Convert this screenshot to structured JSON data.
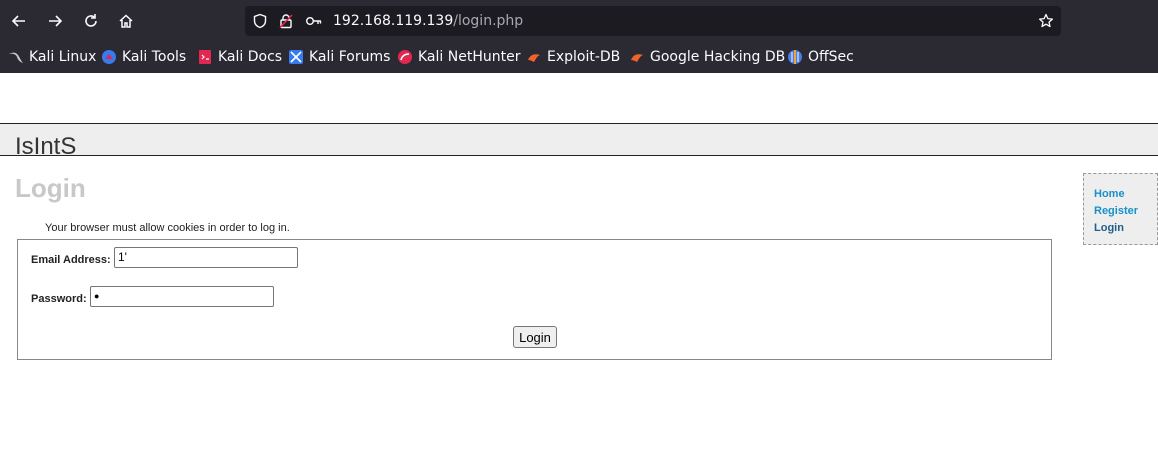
{
  "browser": {
    "url_host": "192.168.119.139",
    "url_path": "/login.php",
    "bookmarks": [
      {
        "label": "Kali Linux",
        "icon": "kali-dragon-icon"
      },
      {
        "label": "Kali Tools",
        "icon": "kali-tools-icon"
      },
      {
        "label": "Kali Docs",
        "icon": "kali-docs-icon"
      },
      {
        "label": "Kali Forums",
        "icon": "kali-forums-icon"
      },
      {
        "label": "Kali NetHunter",
        "icon": "kali-nethunter-icon"
      },
      {
        "label": "Exploit-DB",
        "icon": "exploit-db-icon"
      },
      {
        "label": "Google Hacking DB",
        "icon": "ghdb-icon"
      },
      {
        "label": "OffSec",
        "icon": "offsec-icon"
      }
    ]
  },
  "site": {
    "title": "IsIntS"
  },
  "login": {
    "heading": "Login",
    "cookie_note": "Your browser must allow cookies in order to log in.",
    "email_label": "Email Address:",
    "email_value": "1'",
    "password_label": "Password:",
    "password_value": "●",
    "submit_label": "Login"
  },
  "sidebar": {
    "links": [
      "Home",
      "Register",
      "Login"
    ]
  }
}
